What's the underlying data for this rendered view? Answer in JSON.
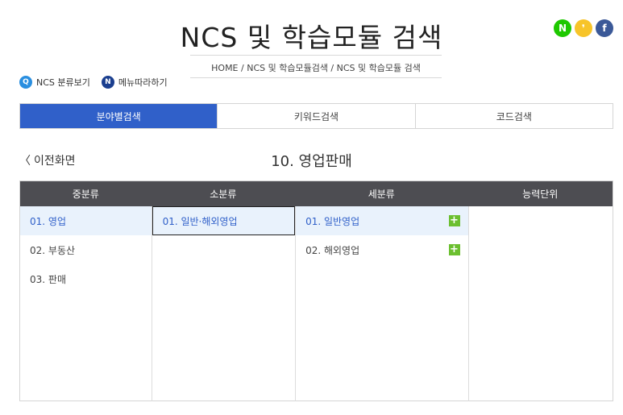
{
  "header": {
    "title": "NCS 및 학습모듈 검색",
    "breadcrumb": "HOME / NCS 및 학습모듈검색 / NCS 및 학습모듈 검색"
  },
  "social": [
    {
      "name": "naver-icon",
      "glyph": "N",
      "color": "#1ec800"
    },
    {
      "name": "kakao-icon",
      "glyph": "❜",
      "color": "#f7c429"
    },
    {
      "name": "facebook-icon",
      "glyph": "f",
      "color": "#3b5998"
    }
  ],
  "quick_links": {
    "ncs_view": "NCS 분류보기",
    "menu_follow": "메뉴따라하기",
    "ncs_badge": "Q",
    "menu_badge": "N"
  },
  "tabs": [
    {
      "label": "분야별검색",
      "active": true
    },
    {
      "label": "키워드검색",
      "active": false
    },
    {
      "label": "코드검색",
      "active": false
    }
  ],
  "nav": {
    "back_glyph": "〈",
    "back_label": "이전화면",
    "section_title": "10. 영업판매"
  },
  "table": {
    "headers": [
      "중분류",
      "소분류",
      "세분류",
      "능력단위"
    ],
    "col1": [
      "01. 영업",
      "02. 부동산",
      "03. 판매"
    ],
    "col2": [
      "01. 일반·해외영업"
    ],
    "col3": [
      "01. 일반영업",
      "02. 해외영업"
    ],
    "plus_glyph": "+"
  },
  "colors": {
    "accent": "#3060c9",
    "header_bg": "#4d4d52",
    "selected_bg": "#e9f2fc",
    "plus": "#6bbf2f"
  }
}
